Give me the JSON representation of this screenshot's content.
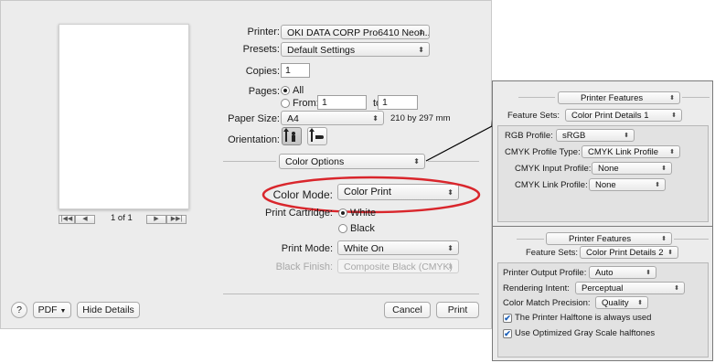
{
  "printer": {
    "label": "Printer:",
    "value": "OKI DATA CORP Pro6410 Neon..."
  },
  "presets": {
    "label": "Presets:",
    "value": "Default Settings"
  },
  "copies": {
    "label": "Copies:",
    "value": "1"
  },
  "pages": {
    "label": "Pages:",
    "all": "All",
    "from": "From:",
    "from_value": "1",
    "to": "to:",
    "to_value": "1",
    "selected": "All"
  },
  "paper_size": {
    "label": "Paper Size:",
    "value": "A4",
    "dims": "210 by 297 mm"
  },
  "orientation": {
    "label": "Orientation:"
  },
  "section": {
    "value": "Color Options"
  },
  "color_mode": {
    "label": "Color Mode:",
    "value": "Color Print"
  },
  "print_cartridge": {
    "label": "Print Cartridge:",
    "white": "White",
    "black": "Black",
    "selected": "White"
  },
  "print_mode": {
    "label": "Print Mode:",
    "value": "White On"
  },
  "black_finish": {
    "label": "Black Finish:",
    "value": "Composite Black (CMYK)"
  },
  "preview_nav": {
    "page_indicator": "1 of 1"
  },
  "footer": {
    "help": "?",
    "pdf": "PDF",
    "hide_details": "Hide Details",
    "cancel": "Cancel",
    "print": "Print"
  },
  "panel1": {
    "header": "Printer Features",
    "feature_sets_label": "Feature Sets:",
    "feature_sets_value": "Color Print Details 1",
    "rgb_profile_label": "RGB Profile:",
    "rgb_profile_value": "sRGB",
    "cmyk_profile_type_label": "CMYK Profile Type:",
    "cmyk_profile_type_value": "CMYK Link Profile",
    "cmyk_input_profile_label": "CMYK Input Profile:",
    "cmyk_input_profile_value": "None",
    "cmyk_link_profile_label": "CMYK Link Profile:",
    "cmyk_link_profile_value": "None"
  },
  "panel2": {
    "header": "Printer Features",
    "feature_sets_label": "Feature Sets:",
    "feature_sets_value": "Color Print Details 2",
    "output_profile_label": "Printer Output Profile:",
    "output_profile_value": "Auto",
    "rendering_intent_label": "Rendering Intent:",
    "rendering_intent_value": "Perceptual",
    "match_precision_label": "Color Match Precision:",
    "match_precision_value": "Quality",
    "halftone_label": "The Printer Halftone is always used",
    "gray_label": "Use Optimized Gray Scale halftones",
    "halftone_checked": true,
    "gray_checked": true
  },
  "colors": {
    "highlight": "#d9262c",
    "callout": "#000000"
  }
}
